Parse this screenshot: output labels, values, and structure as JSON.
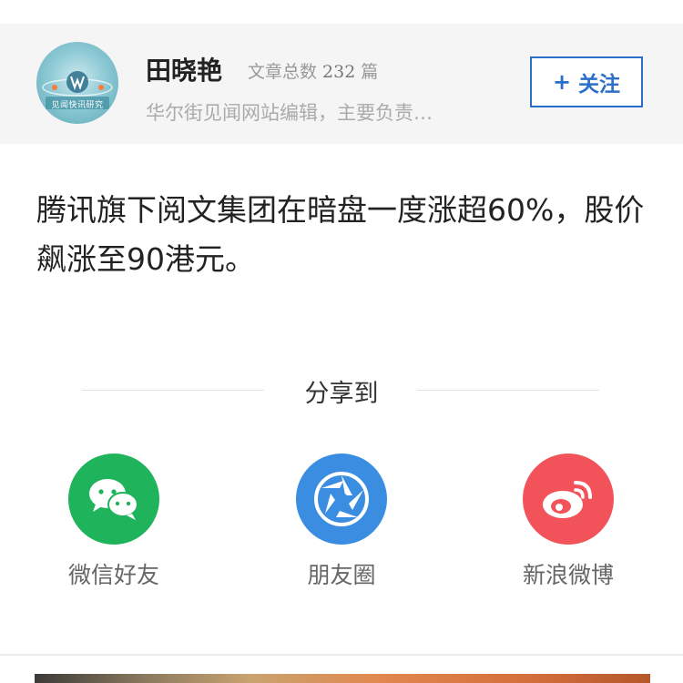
{
  "author": {
    "name": "田晓艳",
    "article_count_label": "文章总数",
    "article_count": "232",
    "article_count_unit": "篇",
    "description": "华尔街见闻网站编辑，主要负责…",
    "avatar_caption": "见闻快讯研究"
  },
  "follow": {
    "plus": "+",
    "label": "关注"
  },
  "article": {
    "text": "腾讯旗下阅文集团在暗盘一度涨超60%，股价飙涨至90港元。"
  },
  "share": {
    "title": "分享到",
    "items": [
      {
        "label": "微信好友",
        "icon": "wechat-icon",
        "color": "#1fb35c"
      },
      {
        "label": "朋友圈",
        "icon": "moments-icon",
        "color": "#3a8de0"
      },
      {
        "label": "新浪微博",
        "icon": "weibo-icon",
        "color": "#f2535a"
      }
    ]
  },
  "colors": {
    "accent": "#2a6fc9",
    "card_background": "#f5f5f5"
  }
}
